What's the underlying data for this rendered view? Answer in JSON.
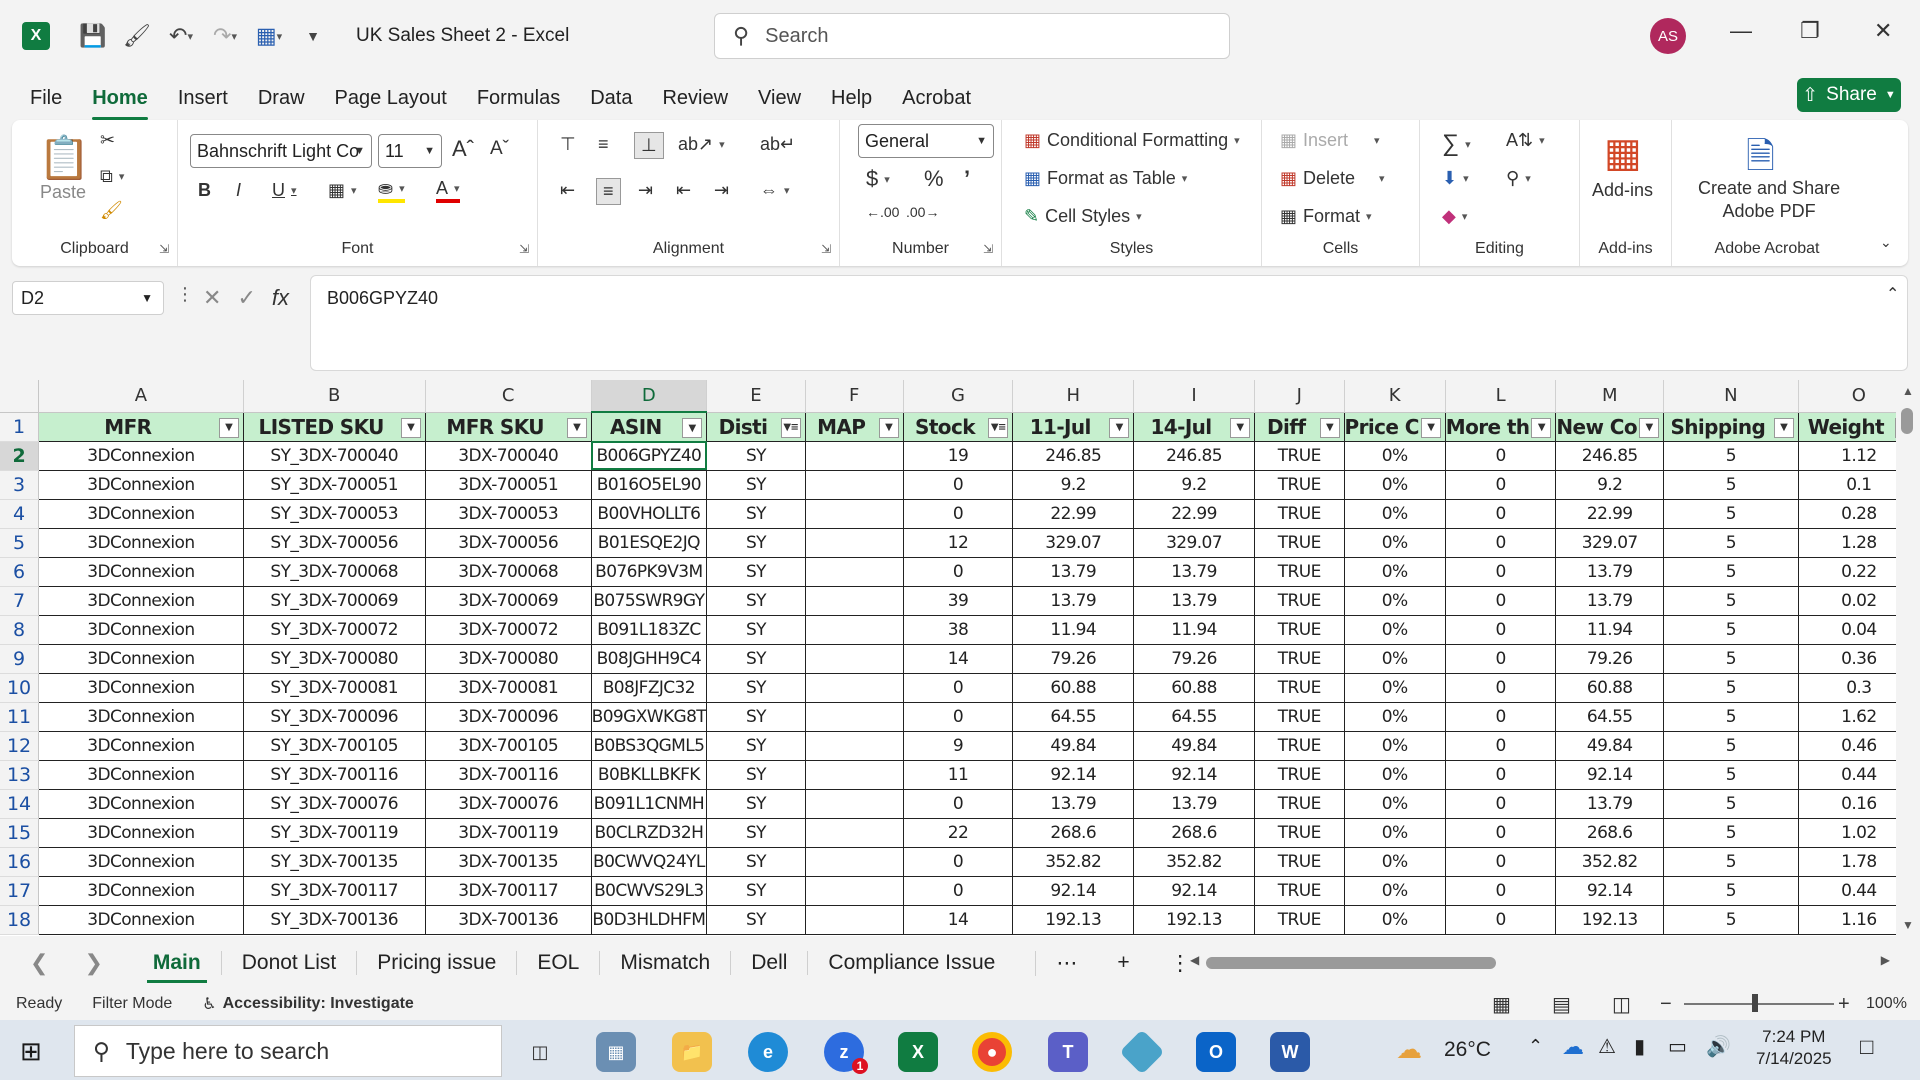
{
  "app": {
    "title": "UK Sales Sheet 2  -  Excel",
    "search_placeholder": "Search",
    "user_initials": "AS",
    "share_label": "Share"
  },
  "menu": [
    "File",
    "Home",
    "Insert",
    "Draw",
    "Page Layout",
    "Formulas",
    "Data",
    "Review",
    "View",
    "Help",
    "Acrobat"
  ],
  "ribbon": {
    "paste": "Paste",
    "font_name": "Bahnschrift Light Co",
    "font_size": "11",
    "number_format": "General",
    "conditional_formatting": "Conditional Formatting",
    "format_as_table": "Format as Table",
    "cell_styles": "Cell Styles",
    "insert": "Insert",
    "delete": "Delete",
    "format": "Format",
    "add_ins": "Add-ins",
    "create_share_line1": "Create and Share",
    "create_share_line2": "Adobe PDF",
    "groups": {
      "clipboard": "Clipboard",
      "font": "Font",
      "alignment": "Alignment",
      "number": "Number",
      "styles": "Styles",
      "cells": "Cells",
      "editing": "Editing",
      "addins": "Add-ins",
      "acrobat": "Adobe Acrobat"
    }
  },
  "namebox": "D2",
  "formula_value": "B006GPYZ40",
  "columns": [
    "A",
    "B",
    "C",
    "D",
    "E",
    "F",
    "G",
    "H",
    "I",
    "J",
    "K",
    "L",
    "M",
    "N",
    "O"
  ],
  "headers": [
    "MFR",
    "LISTED SKU",
    "MFR SKU",
    "ASIN",
    "Disti",
    "MAP",
    "Stock",
    "11-Jul",
    "14-Jul",
    "Diff",
    "Price C",
    "More th",
    "New Co",
    "Shipping",
    "Weight"
  ],
  "rows": [
    {
      "n": "2",
      "c": [
        "3DConnexion",
        "SY_3DX-700040",
        "3DX-700040",
        "B006GPYZ40",
        "SY",
        "",
        "19",
        "246.85",
        "246.85",
        "TRUE",
        "0%",
        "0",
        "246.85",
        "5",
        "1.12"
      ]
    },
    {
      "n": "3",
      "c": [
        "3DConnexion",
        "SY_3DX-700051",
        "3DX-700051",
        "B016O5EL90",
        "SY",
        "",
        "0",
        "9.2",
        "9.2",
        "TRUE",
        "0%",
        "0",
        "9.2",
        "5",
        "0.1"
      ]
    },
    {
      "n": "4",
      "c": [
        "3DConnexion",
        "SY_3DX-700053",
        "3DX-700053",
        "B00VHOLLT6",
        "SY",
        "",
        "0",
        "22.99",
        "22.99",
        "TRUE",
        "0%",
        "0",
        "22.99",
        "5",
        "0.28"
      ]
    },
    {
      "n": "5",
      "c": [
        "3DConnexion",
        "SY_3DX-700056",
        "3DX-700056",
        "B01ESQE2JQ",
        "SY",
        "",
        "12",
        "329.07",
        "329.07",
        "TRUE",
        "0%",
        "0",
        "329.07",
        "5",
        "1.28"
      ]
    },
    {
      "n": "6",
      "c": [
        "3DConnexion",
        "SY_3DX-700068",
        "3DX-700068",
        "B076PK9V3M",
        "SY",
        "",
        "0",
        "13.79",
        "13.79",
        "TRUE",
        "0%",
        "0",
        "13.79",
        "5",
        "0.22"
      ]
    },
    {
      "n": "7",
      "c": [
        "3DConnexion",
        "SY_3DX-700069",
        "3DX-700069",
        "B075SWR9GY",
        "SY",
        "",
        "39",
        "13.79",
        "13.79",
        "TRUE",
        "0%",
        "0",
        "13.79",
        "5",
        "0.02"
      ]
    },
    {
      "n": "8",
      "c": [
        "3DConnexion",
        "SY_3DX-700072",
        "3DX-700072",
        "B091L183ZC",
        "SY",
        "",
        "38",
        "11.94",
        "11.94",
        "TRUE",
        "0%",
        "0",
        "11.94",
        "5",
        "0.04"
      ]
    },
    {
      "n": "9",
      "c": [
        "3DConnexion",
        "SY_3DX-700080",
        "3DX-700080",
        "B08JGHH9C4",
        "SY",
        "",
        "14",
        "79.26",
        "79.26",
        "TRUE",
        "0%",
        "0",
        "79.26",
        "5",
        "0.36"
      ]
    },
    {
      "n": "10",
      "c": [
        "3DConnexion",
        "SY_3DX-700081",
        "3DX-700081",
        "B08JFZJC32",
        "SY",
        "",
        "0",
        "60.88",
        "60.88",
        "TRUE",
        "0%",
        "0",
        "60.88",
        "5",
        "0.3"
      ]
    },
    {
      "n": "11",
      "c": [
        "3DConnexion",
        "SY_3DX-700096",
        "3DX-700096",
        "B09GXWKG8T",
        "SY",
        "",
        "0",
        "64.55",
        "64.55",
        "TRUE",
        "0%",
        "0",
        "64.55",
        "5",
        "1.62"
      ]
    },
    {
      "n": "12",
      "c": [
        "3DConnexion",
        "SY_3DX-700105",
        "3DX-700105",
        "B0BS3QGML5",
        "SY",
        "",
        "9",
        "49.84",
        "49.84",
        "TRUE",
        "0%",
        "0",
        "49.84",
        "5",
        "0.46"
      ]
    },
    {
      "n": "13",
      "c": [
        "3DConnexion",
        "SY_3DX-700116",
        "3DX-700116",
        "B0BKLLBKFK",
        "SY",
        "",
        "11",
        "92.14",
        "92.14",
        "TRUE",
        "0%",
        "0",
        "92.14",
        "5",
        "0.44"
      ]
    },
    {
      "n": "14",
      "c": [
        "3DConnexion",
        "SY_3DX-700076",
        "3DX-700076",
        "B091L1CNMH",
        "SY",
        "",
        "0",
        "13.79",
        "13.79",
        "TRUE",
        "0%",
        "0",
        "13.79",
        "5",
        "0.16"
      ]
    },
    {
      "n": "15",
      "c": [
        "3DConnexion",
        "SY_3DX-700119",
        "3DX-700119",
        "B0CLRZD32H",
        "SY",
        "",
        "22",
        "268.6",
        "268.6",
        "TRUE",
        "0%",
        "0",
        "268.6",
        "5",
        "1.02"
      ]
    },
    {
      "n": "16",
      "c": [
        "3DConnexion",
        "SY_3DX-700135",
        "3DX-700135",
        "B0CWVQ24YL",
        "SY",
        "",
        "0",
        "352.82",
        "352.82",
        "TRUE",
        "0%",
        "0",
        "352.82",
        "5",
        "1.78"
      ]
    },
    {
      "n": "17",
      "c": [
        "3DConnexion",
        "SY_3DX-700117",
        "3DX-700117",
        "B0CWVS29L3",
        "SY",
        "",
        "0",
        "92.14",
        "92.14",
        "TRUE",
        "0%",
        "0",
        "92.14",
        "5",
        "0.44"
      ]
    },
    {
      "n": "18",
      "c": [
        "3DConnexion",
        "SY_3DX-700136",
        "3DX-700136",
        "B0D3HLDHFM",
        "SY",
        "",
        "14",
        "192.13",
        "192.13",
        "TRUE",
        "0%",
        "0",
        "192.13",
        "5",
        "1.16"
      ]
    }
  ],
  "sheets": [
    "Main",
    "Donot List",
    "Pricing issue",
    "EOL",
    "Mismatch",
    "Dell",
    "Compliance Issue"
  ],
  "status": {
    "ready": "Ready",
    "filter_mode": "Filter Mode",
    "accessibility": "Accessibility: Investigate",
    "zoom": "100%"
  },
  "taskbar": {
    "search_placeholder": "Type here to search",
    "weather": "26°C",
    "time": "7:24 PM",
    "date": "7/14/2025",
    "zoom_badge": "1"
  },
  "colors": {
    "excel_green": "#107c41",
    "header_fill": "#c6efce",
    "avatar": "#b0285d"
  }
}
